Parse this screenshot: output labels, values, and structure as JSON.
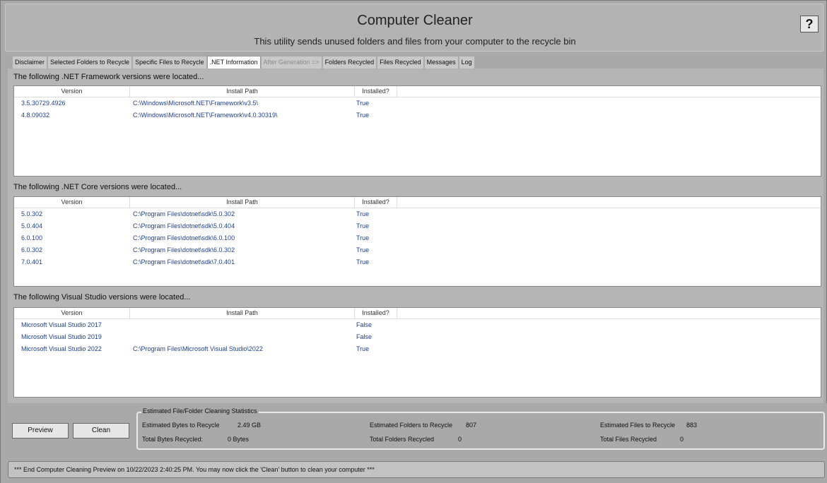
{
  "app": {
    "title": "Computer Cleaner",
    "subtitle": "This utility sends unused folders and files from your computer to the recycle bin",
    "help_label": "?"
  },
  "tabs": [
    {
      "label": "Disclaimer"
    },
    {
      "label": "Selected Folders to Recycle"
    },
    {
      "label": "Specific Files to Recycle"
    },
    {
      "label": ".NET Information"
    },
    {
      "label": "After Generation =>"
    },
    {
      "label": "Folders Recycled"
    },
    {
      "label": "Files Recycled"
    },
    {
      "label": "Messages"
    },
    {
      "label": "Log"
    }
  ],
  "framework": {
    "label": "The following .NET Framework versions were located...",
    "headers": {
      "version": "Version",
      "path": "Install Path",
      "installed": "Installed?"
    },
    "rows": [
      {
        "version": "3.5.30729.4926",
        "path": "C:\\Windows\\Microsoft.NET\\Framework\\v3.5\\",
        "installed": "True"
      },
      {
        "version": "4.8.09032",
        "path": "C:\\Windows\\Microsoft.NET\\Framework\\v4.0.30319\\",
        "installed": "True"
      }
    ]
  },
  "core": {
    "label": "The following .NET Core versions were located...",
    "headers": {
      "version": "Version",
      "path": "Install Path",
      "installed": "Installed?"
    },
    "rows": [
      {
        "version": "5.0.302",
        "path": "C:\\Program Files\\dotnet\\sdk\\5.0.302",
        "installed": "True"
      },
      {
        "version": "5.0.404",
        "path": "C:\\Program Files\\dotnet\\sdk\\5.0.404",
        "installed": "True"
      },
      {
        "version": "6.0.100",
        "path": "C:\\Program Files\\dotnet\\sdk\\6.0.100",
        "installed": "True"
      },
      {
        "version": "6.0.302",
        "path": "C:\\Program Files\\dotnet\\sdk\\6.0.302",
        "installed": "True"
      },
      {
        "version": "7.0.401",
        "path": "C:\\Program Files\\dotnet\\sdk\\7.0.401",
        "installed": "True"
      }
    ]
  },
  "vs": {
    "label": "The following Visual Studio versions were located...",
    "headers": {
      "version": "Version",
      "path": "Install Path",
      "installed": "Installed?"
    },
    "rows": [
      {
        "version": "Microsoft Visual Studio 2017",
        "path": "",
        "installed": "False"
      },
      {
        "version": "Microsoft Visual Studio 2019",
        "path": "",
        "installed": "False"
      },
      {
        "version": "Microsoft Visual Studio 2022",
        "path": "C:\\Program Files\\Microsoft Visual Studio\\2022",
        "installed": "True"
      }
    ]
  },
  "buttons": {
    "preview": "Preview",
    "clean": "Clean"
  },
  "stats": {
    "legend": "Estimated File/Folder Cleaning Statistics",
    "est_bytes_label": "Estimated Bytes to Recycle",
    "est_bytes_value": "2.49 GB",
    "total_bytes_label": "Total Bytes Recycled:",
    "total_bytes_value": "0 Bytes",
    "est_folders_label": "Estimated Folders to Recycle",
    "est_folders_value": "807",
    "total_folders_label": "Total Folders Recycled",
    "total_folders_value": "0",
    "est_files_label": "Estimated Files to Recycle",
    "est_files_value": "883",
    "total_files_label": "Total Files Recycled",
    "total_files_value": "0"
  },
  "status": "*** End Computer Cleaning Preview on 10/22/2023 2:40:25 PM. You may now click the 'Clean' button to clean your computer ***"
}
